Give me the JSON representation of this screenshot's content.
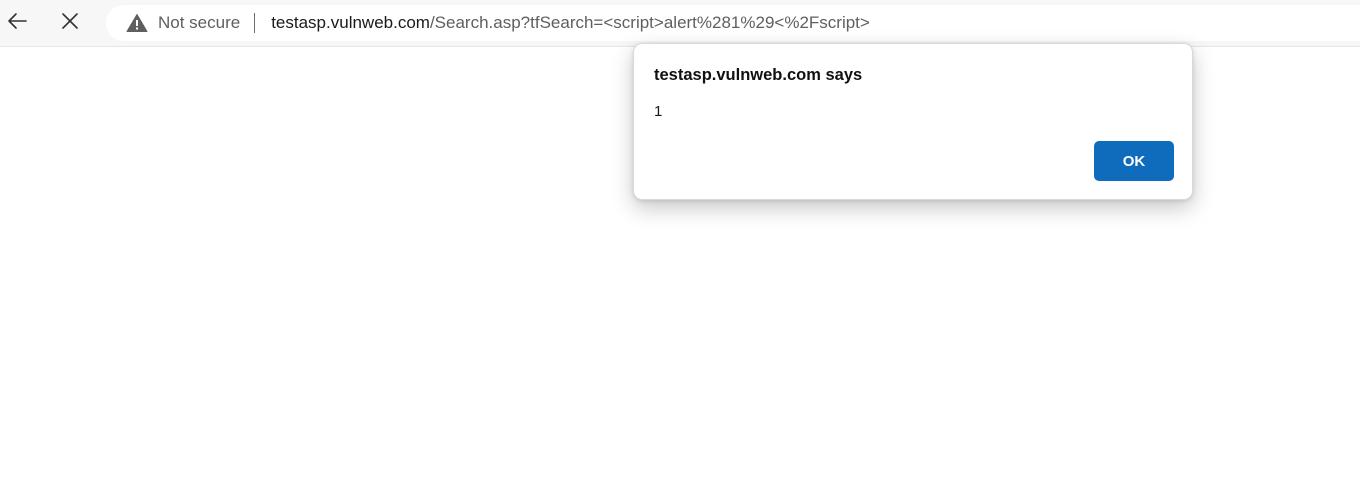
{
  "browser": {
    "security_label": "Not secure",
    "url_host": "testasp.vulnweb.com",
    "url_path": "/Search.asp?tfSearch=<script>alert%281%29<%2Fscript>",
    "icons": {
      "back": "arrow-left-icon",
      "stop": "close-icon",
      "security": "warning-triangle-icon"
    }
  },
  "dialog": {
    "title": "testasp.vulnweb.com says",
    "message": "1",
    "ok_label": "OK",
    "ok_color": "#0f6cbd"
  }
}
